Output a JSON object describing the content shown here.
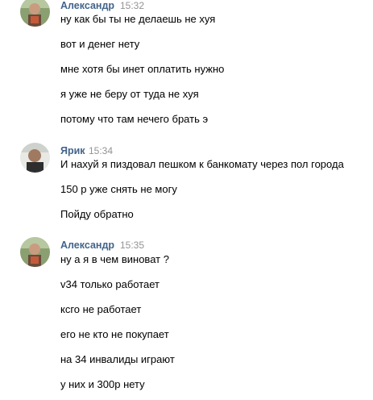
{
  "messages": [
    {
      "author": "Александр",
      "time": "15:32",
      "avatar": "avatar-aleksandr",
      "lines": [
        "ну как бы ты не делаешь не хуя",
        "вот и денег нету",
        "мне хотя бы инет оплатить нужно",
        "я уже не беру от туда не хуя",
        "потому что там нечего брать э"
      ]
    },
    {
      "author": "Ярик",
      "time": "15:34",
      "avatar": "avatar-yarik",
      "lines": [
        "И нахуй я пиздовал пешком к банкомату через пол города",
        "150 р уже снять не могу",
        "Пойду обратно"
      ]
    },
    {
      "author": "Александр",
      "time": "15:35",
      "avatar": "avatar-aleksandr",
      "lines": [
        "ну а я в чем виноват ?",
        "v34 только работает",
        "ксго не работает",
        "его не кто не покупает",
        "на 34 инвалиды играют",
        "у них и 300р нету"
      ]
    }
  ],
  "colors": {
    "author": "#42648b",
    "time": "#939393",
    "text": "#000000"
  }
}
